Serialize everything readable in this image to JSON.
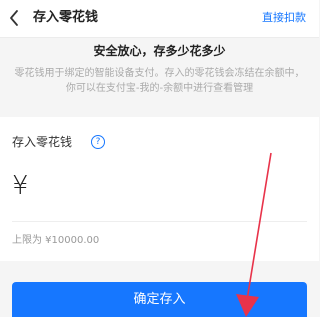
{
  "nav": {
    "back_icon": "chevron-left-icon",
    "title": "存入零花钱",
    "action": "直接扣款"
  },
  "banner": {
    "headline": "安全放心，存多少花多少",
    "description": "零花钱用于绑定的智能设备支付。存入的零花钱会冻结在余额中，你可以在支付宝-我的-余额中进行查看管理"
  },
  "deposit": {
    "label": "存入零花钱",
    "help_icon": "question-circle-icon",
    "help_glyph": "?",
    "currency_symbol": "¥",
    "amount_value": "",
    "amount_placeholder": "",
    "limit_text": "上限为 ¥10000.00"
  },
  "confirm": {
    "label": "确定存入"
  },
  "colors": {
    "accent": "#1677ff",
    "annotation_arrow": "#e8334a"
  }
}
